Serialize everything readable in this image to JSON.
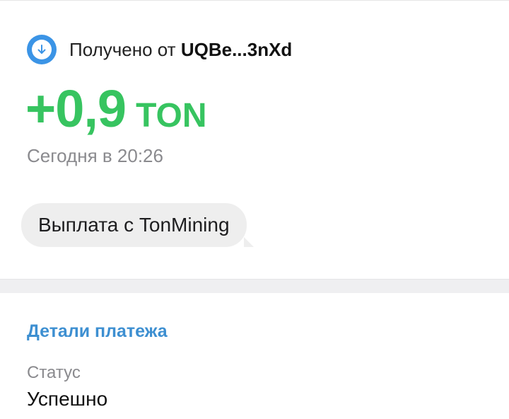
{
  "transaction": {
    "received_prefix": "Получено от",
    "sender_address": "UQBe...3nXd",
    "amount_value": "+0,9",
    "amount_currency": "TON",
    "date_text": "Сегодня в 20:26",
    "comment": "Выплата с TonMining",
    "icon": "arrow-down-circle-icon",
    "accent_color": "#37c460",
    "icon_color": "#3b94e6"
  },
  "details": {
    "section_title": "Детали платежа",
    "status_label": "Статус",
    "status_value": "Успешно",
    "title_color": "#3d8fd1"
  }
}
